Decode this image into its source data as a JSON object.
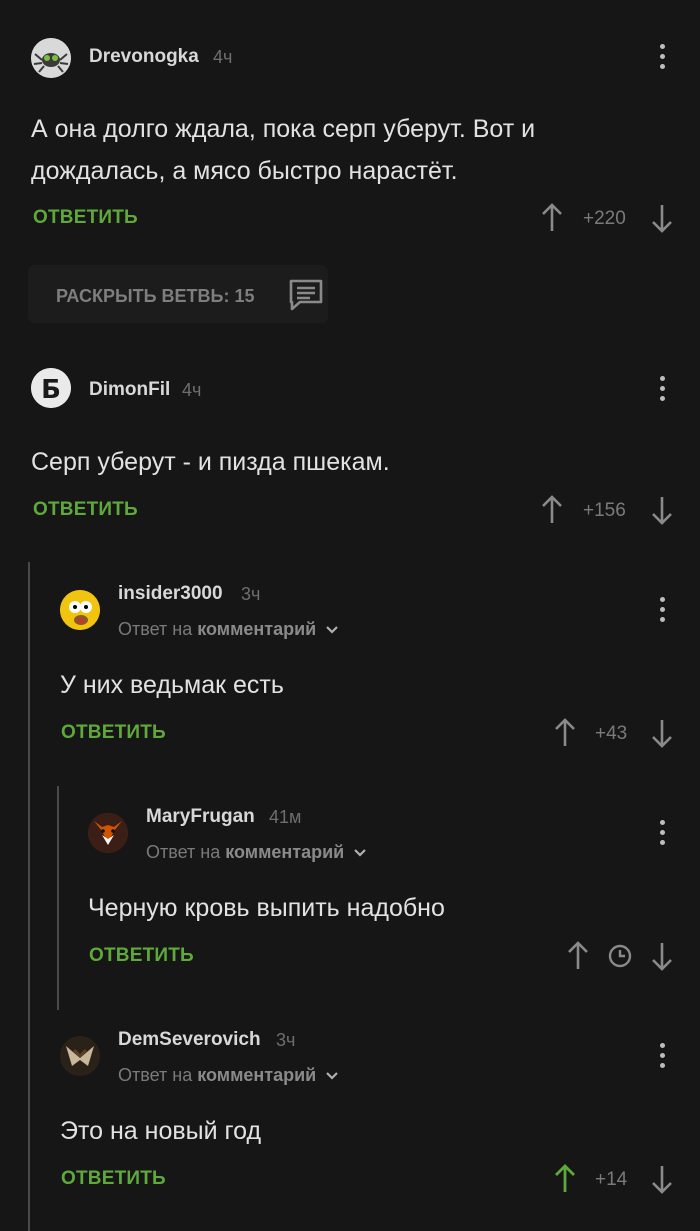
{
  "comments": [
    {
      "username": "Drevonogka",
      "time": "4ч",
      "text_line1": "А она долго ждала, пока серп уберут. Вот и",
      "text_line2": "дождалась, а мясо быстро нарастёт.",
      "reply": "ОТВЕТИТЬ",
      "rating": "+220"
    },
    {
      "username": "DimonFil",
      "time": "4ч",
      "text": "Серп уберут - и пизда пшекам.",
      "reply": "ОТВЕТИТЬ",
      "rating": "+156"
    },
    {
      "username": "insider3000",
      "time": "3ч",
      "reply_to_prefix": "Ответ на",
      "reply_to_target": "комментарий",
      "text": "У них ведьмак есть",
      "reply": "ОТВЕТИТЬ",
      "rating": "+43"
    },
    {
      "username": "MaryFrugan",
      "time": "41м",
      "reply_to_prefix": "Ответ на",
      "reply_to_target": "комментарий",
      "text": "Черную кровь выпить надобно",
      "reply": "ОТВЕТИТЬ"
    },
    {
      "username": "DemSeverovich",
      "time": "3ч",
      "reply_to_prefix": "Ответ на",
      "reply_to_target": "комментарий",
      "text": "Это на новый год",
      "reply": "ОТВЕТИТЬ",
      "rating": "+14"
    }
  ],
  "thread": {
    "label": "РАСКРЫТЬ ВЕТВЬ: 15"
  },
  "colors": {
    "background": "#161616",
    "accent_green": "#5fa83a",
    "muted": "#7a7a7a",
    "text": "#e2e2e2"
  },
  "avatar_letter": "Б"
}
